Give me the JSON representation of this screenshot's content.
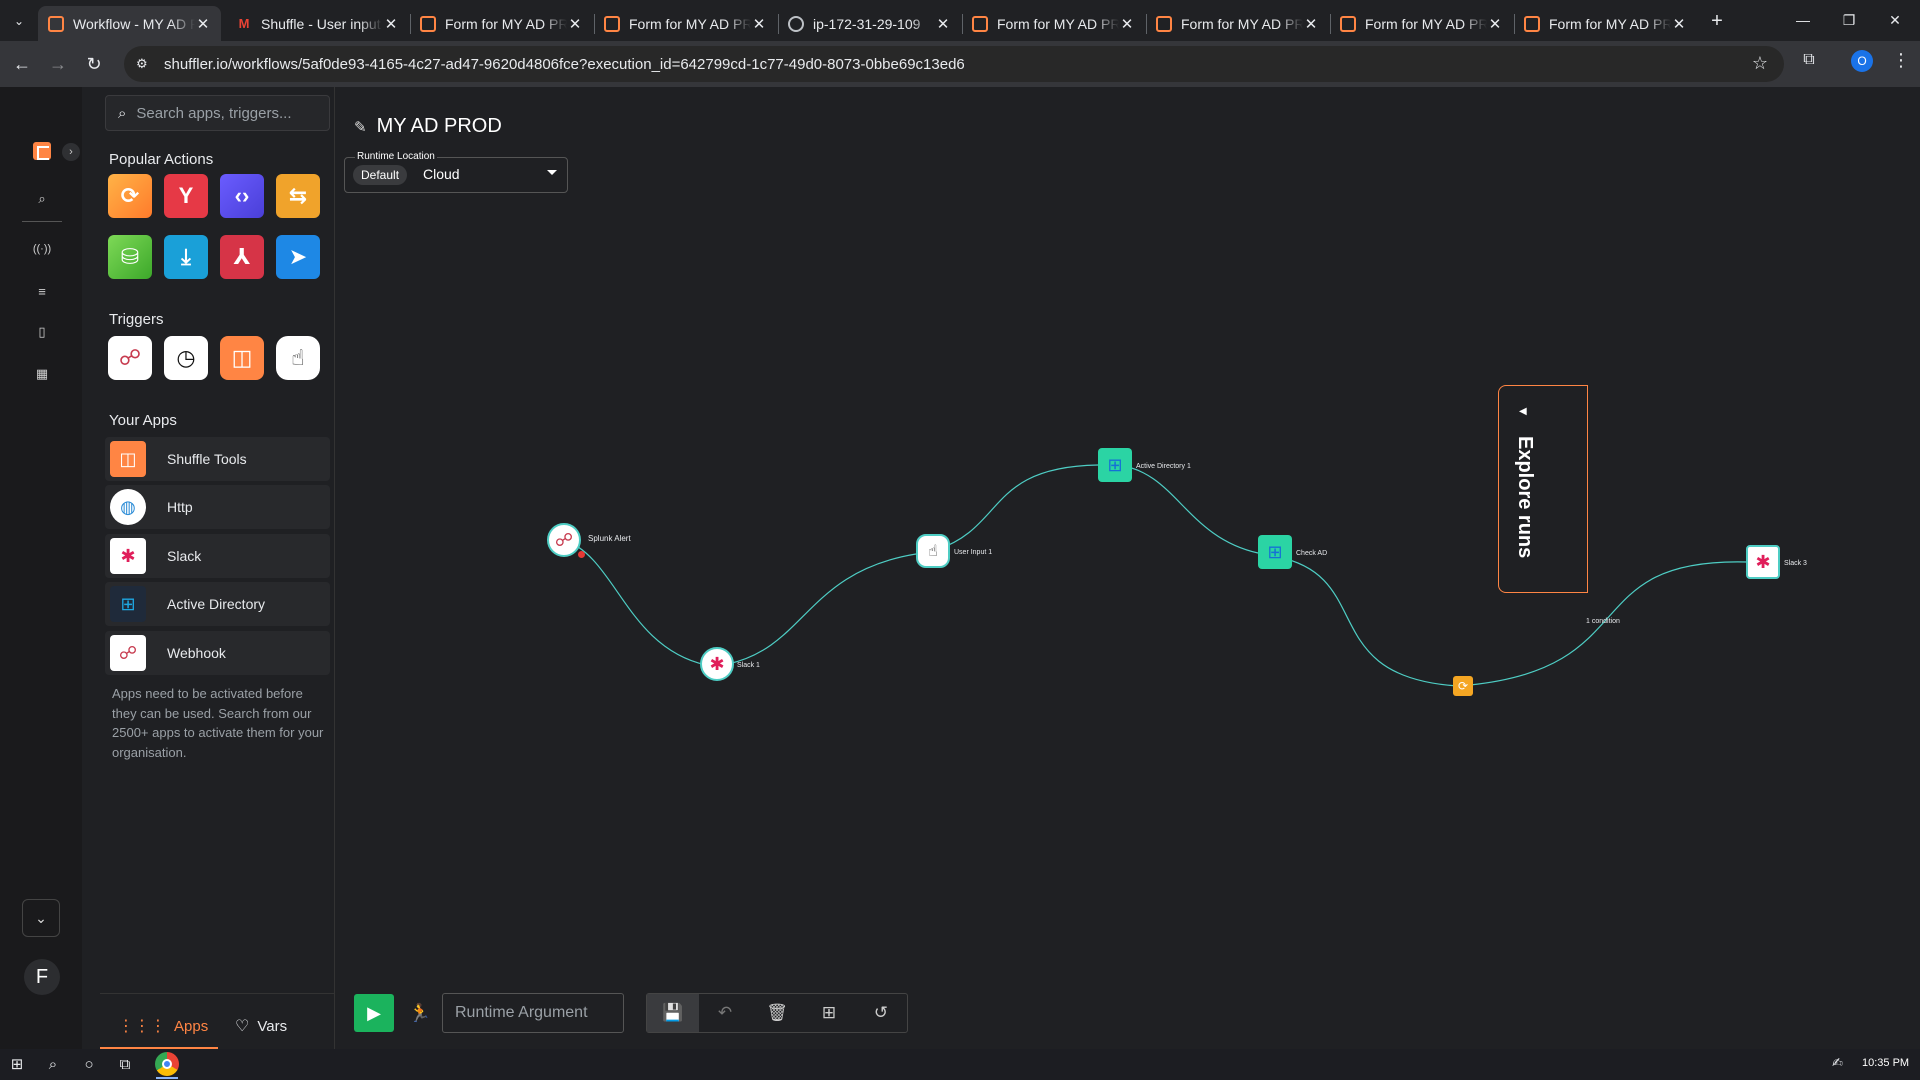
{
  "browser": {
    "tabs": [
      {
        "title": "Workflow - MY AD PROD",
        "icon": "shuffle",
        "active": true
      },
      {
        "title": "Shuffle - User input required",
        "icon": "gmail"
      },
      {
        "title": "Form for MY AD PROD",
        "icon": "shuffle"
      },
      {
        "title": "Form for MY AD PROD",
        "icon": "shuffle"
      },
      {
        "title": "ip-172-31-29-109",
        "icon": "globe"
      },
      {
        "title": "Form for MY AD PROD",
        "icon": "shuffle"
      },
      {
        "title": "Form for MY AD PROD",
        "icon": "shuffle"
      },
      {
        "title": "Form for MY AD PROD",
        "icon": "shuffle"
      },
      {
        "title": "Form for MY AD PROD",
        "icon": "shuffle"
      }
    ],
    "url": "shuffler.io/workflows/5af0de93-4165-4c27-ad47-9620d4806fce?execution_id=642799cd-1c77-49d0-8073-0bbe69c13ed6",
    "profile_initial": "O"
  },
  "sidebar": {
    "search_placeholder": "Search apps, triggers...",
    "popular_title": "Popular Actions",
    "triggers_title": "Triggers",
    "apps_title": "Your Apps",
    "apps": [
      {
        "name": "Shuffle Tools"
      },
      {
        "name": "Http"
      },
      {
        "name": "Slack"
      },
      {
        "name": "Active Directory"
      },
      {
        "name": "Webhook"
      }
    ],
    "note": "Apps need to be activated before they can be used. Search from our 2500+ apps to activate them for your organisation.",
    "tab_apps": "Apps",
    "tab_vars": "Vars",
    "avatar_initial": "F"
  },
  "workflow": {
    "name": "MY AD PROD",
    "runtime_label": "Runtime Location",
    "runtime_default": "Default",
    "runtime_value": "Cloud",
    "nodes": {
      "splunk": "Splunk Alert",
      "slack1": "Slack 1",
      "userinput": "User Input 1",
      "ad1": "Active Directory 1",
      "checkad": "Check AD",
      "slack3": "Slack 3"
    },
    "edge_label": "1 condition",
    "explore_runs": "Explore runs",
    "runtime_arg_placeholder": "Runtime Argument"
  },
  "taskbar": {
    "time": "10:35 PM"
  },
  "colors": {
    "accent": "#ff8544",
    "edge": "#4ecdc4",
    "run": "#1bb35d"
  }
}
